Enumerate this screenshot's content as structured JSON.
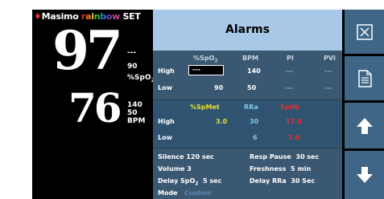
{
  "brand": {
    "prefix": "Masimo",
    "rainbow_letters": [
      "r",
      "a",
      "i",
      "n",
      "b",
      "o",
      "w"
    ],
    "rainbow_colors": [
      "#e03030",
      "#f07a20",
      "#f0d020",
      "#40c040",
      "#3080e0",
      "#8040c0",
      "#d040a0"
    ],
    "suffix": "SET"
  },
  "monitor": {
    "spo2_value": "97",
    "spo2_dash": "---",
    "spo2_limit": "90",
    "spo2_unit": "%SpO2",
    "pr_value": "76",
    "pr_high": "140",
    "pr_low": "50",
    "pr_unit": "BPM"
  },
  "dialog": {
    "title": "Alarms",
    "sec1": {
      "headers": [
        "%SpO2",
        "BPM",
        "PI",
        "PVI"
      ],
      "high_label": "High",
      "low_label": "Low",
      "high": [
        "---",
        "140",
        "---",
        "---"
      ],
      "low": [
        "90",
        "50",
        "---",
        "---"
      ]
    },
    "sec2": {
      "headers": [
        "%SpMet",
        "RRa",
        "SpHb"
      ],
      "high_label": "High",
      "low_label": "Low",
      "high": [
        "3.0",
        "30",
        "17.0"
      ],
      "low": [
        "",
        "6",
        "7.0"
      ]
    },
    "settings": {
      "silence_label": "Silence",
      "silence_value": "120 sec",
      "resp_pause_label": "Resp Pause",
      "resp_pause_value": "30 sec",
      "volume_label": "Volume",
      "volume_value": "3",
      "freshness_label": "Freshness",
      "freshness_value": "5 min",
      "delay_spo2_label": "Delay SpO2",
      "delay_spo2_value": "5 sec",
      "delay_rra_label": "Delay RRa",
      "delay_rra_value": "30 Sec",
      "mode_label": "Mode",
      "mode_value": "Custom"
    }
  },
  "sidebar": {
    "icons": [
      "close-icon",
      "document-icon",
      "arrow-up-icon",
      "arrow-down-icon"
    ],
    "button_color": "#3f6686"
  },
  "colors": {
    "title_bar": "#a8c8e8",
    "panel": "#33495c",
    "highlight_red": "#e83030",
    "highlight_yellow": "#e8e030"
  }
}
